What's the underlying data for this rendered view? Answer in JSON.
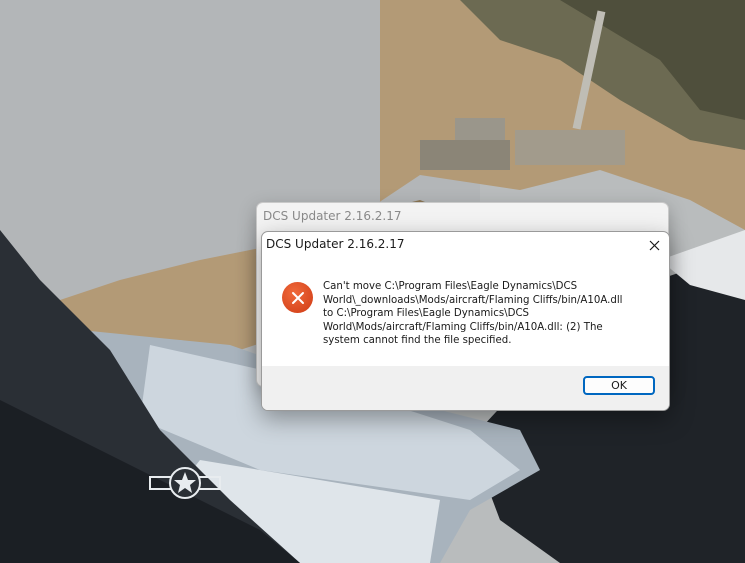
{
  "background_window": {
    "title": "DCS Updater 2.16.2.17"
  },
  "dialog": {
    "title": "DCS Updater 2.16.2.17",
    "close_icon": "close-icon",
    "error_icon": "error-icon",
    "message": "Can't move C:\\Program Files\\Eagle Dynamics\\DCS\nWorld\\_downloads\\Mods/aircraft/Flaming Cliffs/bin/A10A.dll\nto C:\\Program Files\\Eagle Dynamics\\DCS\nWorld\\Mods/aircraft/Flaming Cliffs/bin/A10A.dll: (2) The\nsystem cannot find the file specified.",
    "ok_label": "OK"
  },
  "colors": {
    "accent": "#0067c0",
    "error": "#d9441c"
  }
}
